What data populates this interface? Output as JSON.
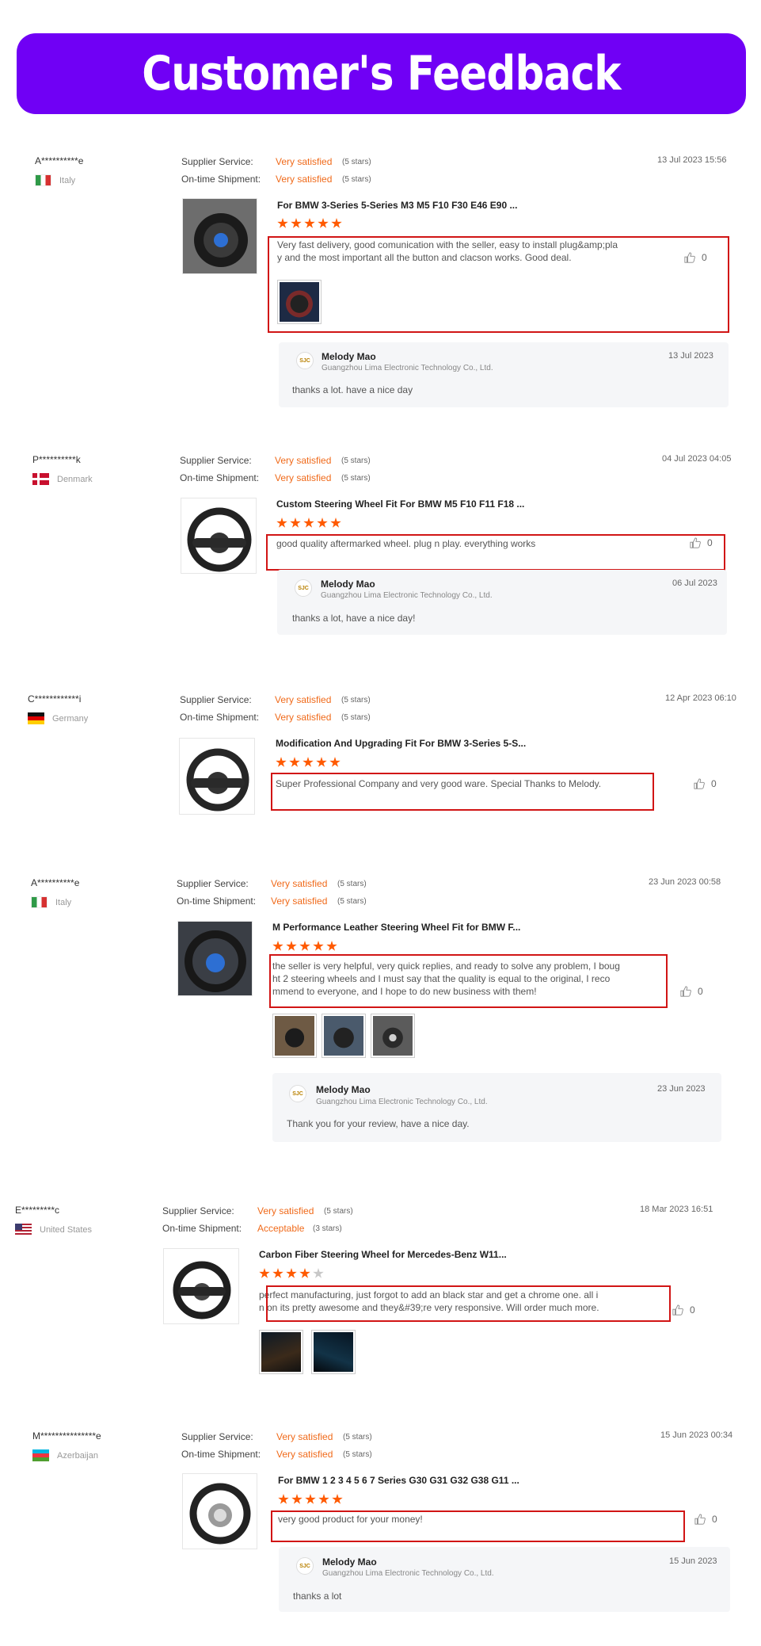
{
  "banner": {
    "title": "Customer's Feedback"
  },
  "labels": {
    "supplier_service": "Supplier Service:",
    "on_time_shipment": "On-time Shipment:"
  },
  "colors": {
    "banner": "#7000f5",
    "accent": "#f06a1a",
    "star": "#ff5a00",
    "highlight": "#d11515"
  },
  "reviews": [
    {
      "user": "A**********e",
      "country": "Italy",
      "supplier_value": "Very satisfied",
      "supplier_stars": "(5 stars)",
      "shipment_value": "Very satisfied",
      "shipment_stars": "(5 stars)",
      "date": "13 Jul 2023 15:56",
      "product_title": "For BMW 3-Series 5-Series M3 M5 F10 F30 E46 E90 ...",
      "rating": 5,
      "text_line1": "Very fast delivery, good comunication with the seller, easy to install plug&amp;pla",
      "text_line2": "y and the most important all the button and clacson works. Good deal.",
      "likes": "0",
      "reply": {
        "name": "Melody Mao",
        "company": "Guangzhou Lima Electronic Technology Co., Ltd.",
        "date": "13 Jul 2023",
        "text": "thanks a lot. have a nice day"
      }
    },
    {
      "user": "P**********k",
      "country": "Denmark",
      "supplier_value": "Very satisfied",
      "supplier_stars": "(5 stars)",
      "shipment_value": "Very satisfied",
      "shipment_stars": "(5 stars)",
      "date": "04 Jul 2023 04:05",
      "product_title": "Custom Steering Wheel Fit For BMW M5 F10 F11 F18 ...",
      "rating": 5,
      "text_line1": "good quality aftermarked wheel. plug n play. everything works",
      "likes": "0",
      "reply": {
        "name": "Melody Mao",
        "company": "Guangzhou Lima Electronic Technology Co., Ltd.",
        "date": "06 Jul 2023",
        "text": "thanks a lot, have a nice day!"
      }
    },
    {
      "user": "C************i",
      "country": "Germany",
      "supplier_value": "Very satisfied",
      "supplier_stars": "(5 stars)",
      "shipment_value": "Very satisfied",
      "shipment_stars": "(5 stars)",
      "date": "12 Apr 2023 06:10",
      "product_title": "Modification And Upgrading Fit For BMW 3-Series 5-S...",
      "rating": 5,
      "text_line1": "Super Professional Company and very good ware. Special Thanks to Melody.",
      "likes": "0"
    },
    {
      "user": "A**********e",
      "country": "Italy",
      "supplier_value": "Very satisfied",
      "supplier_stars": "(5 stars)",
      "shipment_value": "Very satisfied",
      "shipment_stars": "(5 stars)",
      "date": "23 Jun 2023 00:58",
      "product_title": "M Performance Leather Steering Wheel Fit for BMW F...",
      "rating": 5,
      "text_line1": "the seller is very helpful, very quick replies, and ready to solve any problem, I boug",
      "text_line2": "ht 2 steering wheels and I must say that the quality is equal to the original, I reco",
      "text_line3": "mmend to everyone, and I hope to do new business with them!",
      "likes": "0",
      "reply": {
        "name": "Melody Mao",
        "company": "Guangzhou Lima Electronic Technology Co., Ltd.",
        "date": "23 Jun 2023",
        "text": "Thank you for your review, have a nice day."
      }
    },
    {
      "user": "E*********c",
      "country": "United States",
      "supplier_value": "Very satisfied",
      "supplier_stars": "(5 stars)",
      "shipment_value": "Acceptable",
      "shipment_stars": "(3 stars)",
      "date": "18 Mar 2023 16:51",
      "product_title": "Carbon Fiber Steering Wheel for Mercedes-Benz W11...",
      "rating": 4,
      "text_line1": "perfect manufacturing, just forgot to add an black star and get a chrome one. all i",
      "text_line2": "n on its pretty awesome and they&#39;re very responsive. Will order much more.",
      "likes": "0"
    },
    {
      "user": "M***************e",
      "country": "Azerbaijan",
      "supplier_value": "Very satisfied",
      "supplier_stars": "(5 stars)",
      "shipment_value": "Very satisfied",
      "shipment_stars": "(5 stars)",
      "date": "15 Jun 2023 00:34",
      "product_title": "For BMW 1 2 3 4 5 6 7 Series G30 G31 G32 G38 G11 ...",
      "rating": 5,
      "text_line1": "very good product for your money!",
      "likes": "0",
      "reply": {
        "name": "Melody Mao",
        "company": "Guangzhou Lima Electronic Technology Co., Ltd.",
        "date": "15 Jun 2023",
        "text": "thanks a lot"
      }
    }
  ]
}
